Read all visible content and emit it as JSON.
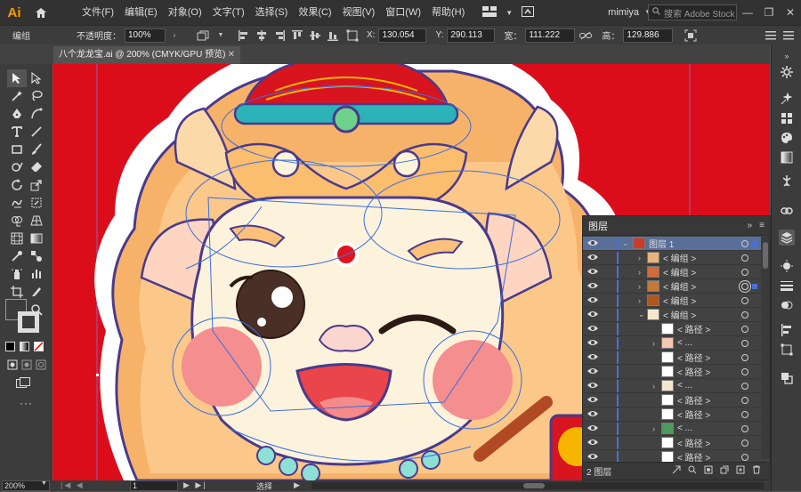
{
  "app": {
    "logo": "Ai",
    "menus": [
      "文件(F)",
      "编辑(E)",
      "对象(O)",
      "文字(T)",
      "选择(S)",
      "效果(C)",
      "视图(V)",
      "窗口(W)",
      "帮助(H)"
    ],
    "user": "mimiya",
    "stock_search_placeholder": "搜索 Adobe Stock"
  },
  "control": {
    "selection": "编组",
    "opacity_label": "不透明度：",
    "opacity": "100%",
    "x_label": "X:",
    "x": "130.054",
    "y_label": "Y:",
    "y": "290.113",
    "w_label": "宽：",
    "w": "111.222",
    "h_label": "高：",
    "h": "129.886"
  },
  "document": {
    "tab": "八个龙龙宝.ai @ 200% (CMYK/GPU 预览)",
    "zoom": "200%",
    "artboard": "1",
    "status": "选择"
  },
  "layers": {
    "tab": "图层",
    "footer_count": "2 图层",
    "rows": [
      {
        "name": "图层 1",
        "indent": 0,
        "arrow": "v",
        "selected": true
      },
      {
        "name": "< 编组 >",
        "indent": 1,
        "arrow": ">"
      },
      {
        "name": "< 编组 >",
        "indent": 1,
        "arrow": ">"
      },
      {
        "name": "< 编组 >",
        "indent": 1,
        "arrow": ">"
      },
      {
        "name": "< 编组 >",
        "indent": 1,
        "arrow": ">"
      },
      {
        "name": "< 编组 >",
        "indent": 1,
        "arrow": "v"
      },
      {
        "name": "< 路径 >",
        "indent": 2,
        "arrow": ""
      },
      {
        "name": "< ...",
        "indent": 2,
        "arrow": ">"
      },
      {
        "name": "< 路径 >",
        "indent": 2,
        "arrow": ""
      },
      {
        "name": "< 路径 >",
        "indent": 2,
        "arrow": ""
      },
      {
        "name": "< ...",
        "indent": 2,
        "arrow": ">"
      },
      {
        "name": "< 路径 >",
        "indent": 2,
        "arrow": ""
      },
      {
        "name": "< 路径 >",
        "indent": 2,
        "arrow": ""
      },
      {
        "name": "< ...",
        "indent": 2,
        "arrow": ">"
      },
      {
        "name": "< 路径 >",
        "indent": 2,
        "arrow": ""
      },
      {
        "name": "< 路径 >",
        "indent": 2,
        "arrow": ""
      }
    ]
  },
  "colors": {
    "canvas_bg": "#dc0d1b",
    "layer_color": "#4a6fd6",
    "selection_path": "#3b6fe0"
  }
}
